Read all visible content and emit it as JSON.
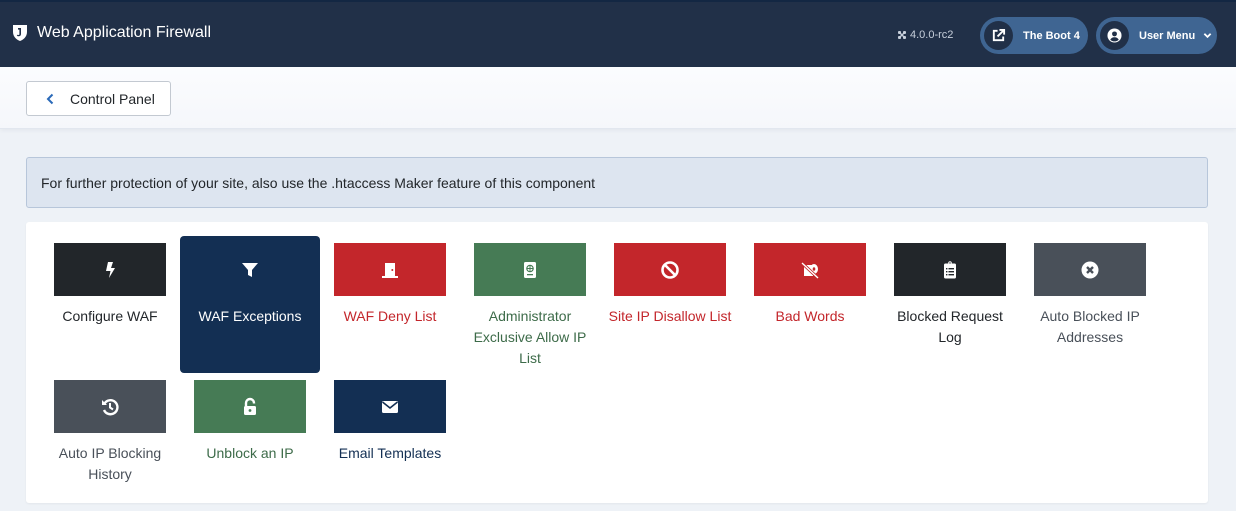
{
  "header": {
    "title": "Web Application Firewall",
    "version": "4.0.0-rc2",
    "site_button": "The Boot 4",
    "user_menu": "User Menu"
  },
  "toolbar": {
    "back_label": "Control Panel"
  },
  "alert": {
    "text": "For further protection of your site, also use the .htaccess Maker feature of this component"
  },
  "colors": {
    "header_bg": "#213048",
    "dark": "#22262a",
    "navy": "#132f53",
    "red": "#c3262b",
    "green": "#467b55",
    "gray": "#495059"
  },
  "tiles": [
    {
      "label": "Configure WAF",
      "icon": "bolt-icon",
      "color": "dark"
    },
    {
      "label": "WAF Exceptions",
      "icon": "filter-icon",
      "color": "navy",
      "active": true
    },
    {
      "label": "WAF Deny List",
      "icon": "door-closed-icon",
      "color": "red"
    },
    {
      "label": "Administrator Exclusive Allow IP List",
      "icon": "passport-icon",
      "color": "green"
    },
    {
      "label": "Site IP Disallow List",
      "icon": "ban-icon",
      "color": "red"
    },
    {
      "label": "Bad Words",
      "icon": "toilet-paper-slash-icon",
      "color": "red"
    },
    {
      "label": "Blocked Request Log",
      "icon": "clipboard-list-icon",
      "color": "dark"
    },
    {
      "label": "Auto Blocked IP Addresses",
      "icon": "times-circle-icon",
      "color": "gray"
    },
    {
      "label": "Auto IP Blocking History",
      "icon": "history-icon",
      "color": "gray"
    },
    {
      "label": "Unblock an IP",
      "icon": "unlock-icon",
      "color": "green"
    },
    {
      "label": "Email Templates",
      "icon": "envelope-icon",
      "color": "navy"
    }
  ]
}
